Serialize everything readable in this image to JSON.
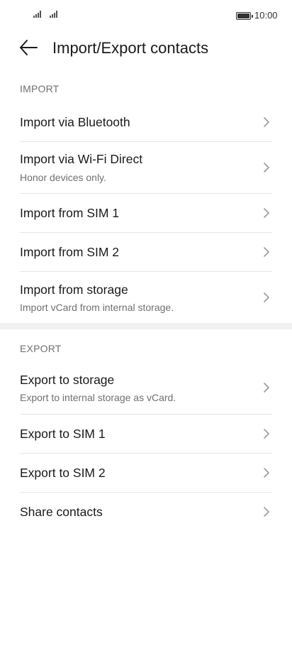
{
  "status_bar": {
    "time": "10:00",
    "icons": [
      "signal-icon",
      "signal-icon",
      "battery-icon"
    ]
  },
  "header": {
    "back_icon": "back-arrow-icon",
    "title": "Import/Export contacts"
  },
  "import": {
    "label": "IMPORT",
    "items": [
      {
        "label": "Import via Bluetooth",
        "sub": ""
      },
      {
        "label": "Import via Wi-Fi Direct",
        "sub": "Honor devices only."
      },
      {
        "label": "Import from SIM 1",
        "sub": ""
      },
      {
        "label": "Import from SIM 2",
        "sub": ""
      },
      {
        "label": "Import from storage",
        "sub": "Import vCard from internal storage."
      }
    ]
  },
  "export": {
    "label": "EXPORT",
    "items": [
      {
        "label": "Export to storage",
        "sub": "Export to internal storage as vCard."
      },
      {
        "label": "Export to SIM 1",
        "sub": ""
      },
      {
        "label": "Export to SIM 2",
        "sub": ""
      },
      {
        "label": "Share contacts",
        "sub": ""
      }
    ]
  },
  "colors": {
    "background": "#ffffff",
    "text": "#1a1a1a",
    "secondary_text": "#707070",
    "chevron": "#9a9a9a",
    "separator": "#e6e6e6",
    "section_band": "#f1f1f1"
  }
}
